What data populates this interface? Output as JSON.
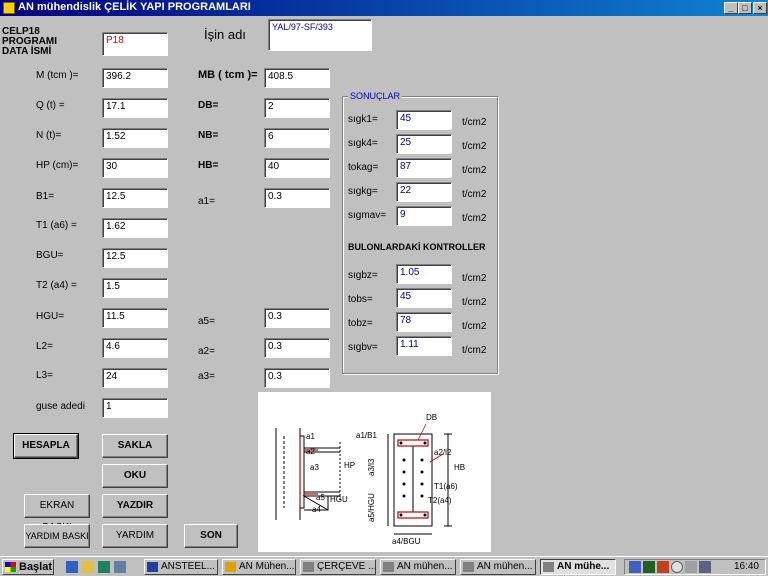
{
  "window": {
    "title": "AN mühendislik  ÇELİK YAPI PROGRAMLARI",
    "controls": [
      "_",
      "□",
      "×"
    ]
  },
  "header": {
    "data_label_1": "CELP18",
    "data_label_2": "PROGRAMI",
    "data_label_3": "DATA  İSMİ",
    "data_value": "P18",
    "job_label": "İşin adı",
    "job_value": "YAL/97-SF/393"
  },
  "left_fields": [
    {
      "label": "M  (tcm )=",
      "value": "396.2"
    },
    {
      "label": "Q  (t) =",
      "value": "17.1"
    },
    {
      "label": "N  (t)=",
      "value": "1.52"
    },
    {
      "label": "HP (cm)=",
      "value": "30"
    },
    {
      "label": "B1=",
      "value": "12.5"
    },
    {
      "label": "T1 (a6) =",
      "value": "1.62"
    },
    {
      "label": "BGU=",
      "value": "12.5"
    },
    {
      "label": "T2  (a4) =",
      "value": "1.5"
    },
    {
      "label": "HGU=",
      "value": "11.5"
    },
    {
      "label": "L2=",
      "value": "4.6"
    },
    {
      "label": "L3=",
      "value": "24"
    },
    {
      "label": "guse adedi",
      "value": "1"
    }
  ],
  "mid_fields": [
    {
      "label": "MB  ( tcm )=",
      "value": "408.5"
    },
    {
      "label": "DB=",
      "value": "2"
    },
    {
      "label": "NB=",
      "value": "6"
    },
    {
      "label": "HB=",
      "value": "40"
    },
    {
      "label": "a1=",
      "value": "0.3"
    },
    {
      "label": "a5=",
      "value": "0.3"
    },
    {
      "label": "a2=",
      "value": "0.3"
    },
    {
      "label": "a3=",
      "value": "0.3"
    }
  ],
  "results": {
    "title": "SONUÇLAR",
    "unit": "t/cm2",
    "items": [
      {
        "label": "sıgk1=",
        "value": "45"
      },
      {
        "label": "sıgk4=",
        "value": "25"
      },
      {
        "label": "tokag=",
        "value": "87"
      },
      {
        "label": "sıgkg=",
        "value": "22"
      },
      {
        "label": "sıgmav=",
        "value": "9"
      }
    ],
    "bolt_title": "BULONLARDAKİ  KONTROLLER",
    "bolt_items": [
      {
        "label": "sıgbz=",
        "value": "1.05"
      },
      {
        "label": "tobs=",
        "value": "45"
      },
      {
        "label": "tobz=",
        "value": "78"
      },
      {
        "label": "sıgbv=",
        "value": "1.11"
      }
    ]
  },
  "buttons": {
    "hesapla": "HESAPLA",
    "sakla": "SAKLA",
    "oku": "OKU",
    "ekran_baski": "EKRAN BASKI",
    "yazdir": "YAZDIR",
    "yardim_baski": "YARDIM BASKI",
    "yardim": "YARDIM",
    "son": "SON"
  },
  "drawing": {
    "labels": {
      "a1": "a1",
      "a2": "a2",
      "a3": "a3",
      "hp": "HP",
      "a5": "a5",
      "hgu": "HGU",
      "a4": "a4",
      "db": "DB",
      "a1b1": "a1/B1",
      "a2l2": "a2/l2",
      "a3l3": "a3/l3",
      "hb": "HB",
      "t1a6": "T1(a6)",
      "t2a4": "T2(a4)",
      "a5hgu": "a5/HGU",
      "a4bgu": "a4/BGU"
    }
  },
  "taskbar": {
    "start": "Başlat",
    "items": [
      "ANSTEEL...",
      "AN Mühen...",
      "ÇERÇEVE ...",
      "AN mühen...",
      "AN mühen...",
      "AN mühe..."
    ],
    "clock": "16:40"
  }
}
